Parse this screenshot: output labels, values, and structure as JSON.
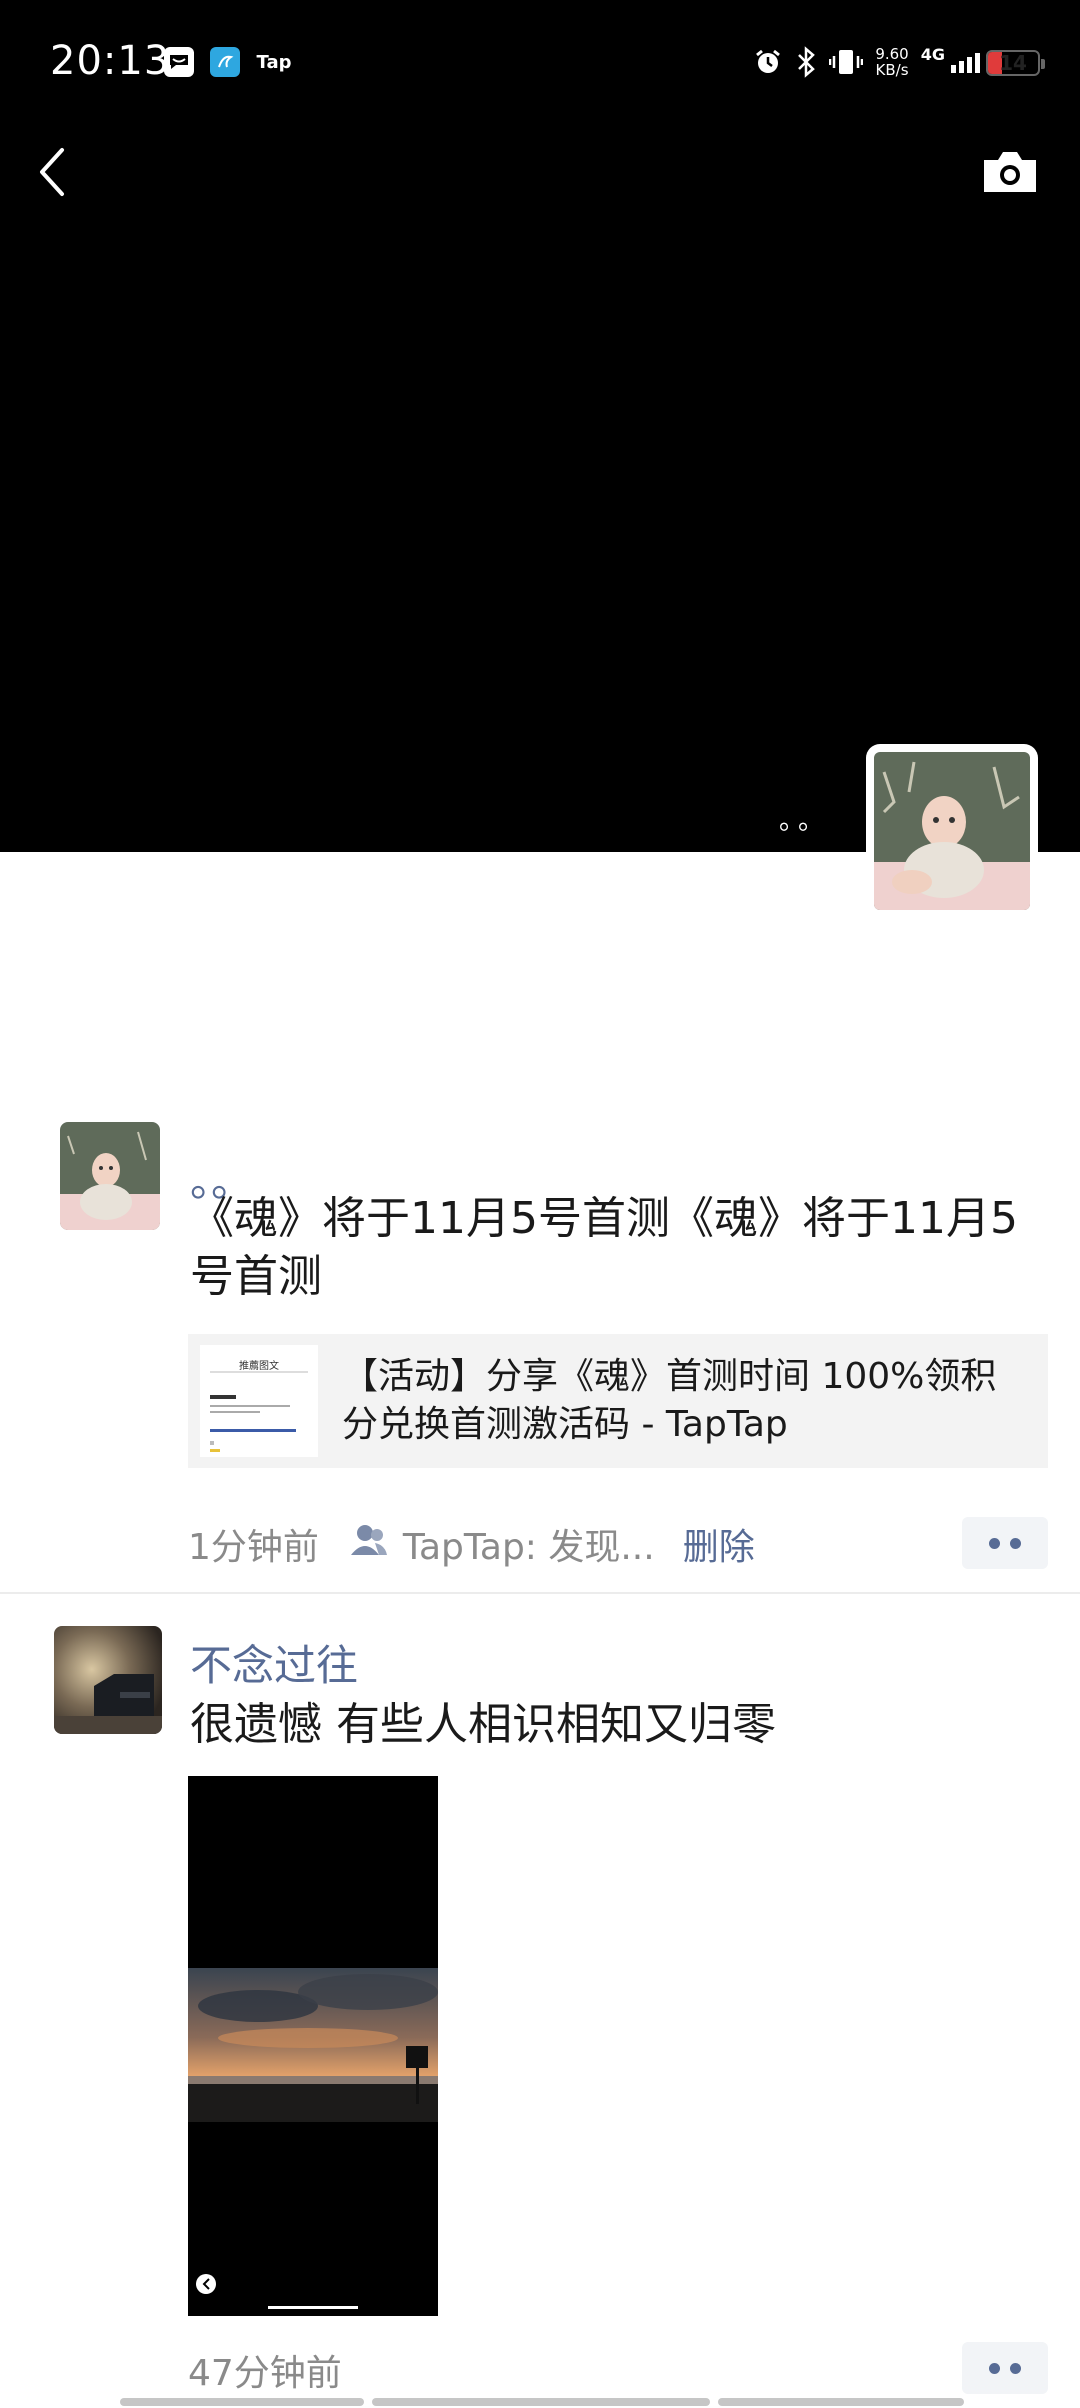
{
  "status_bar": {
    "time": "20:13",
    "app_icons": [
      "message-icon",
      "note-app-icon",
      "tap-app-icon"
    ],
    "tap_label": "Tap",
    "net_speed_value": "9.60",
    "net_speed_unit": "KB/s",
    "network_type": "4G",
    "battery_level": "14"
  },
  "cover": {
    "owner_name": "。。",
    "back_icon": "chevron-left-icon",
    "camera_icon": "camera-icon"
  },
  "posts": [
    {
      "name": "。。",
      "text": "《魂》将于11月5号首测《魂》将于11月5号首测",
      "link_card": {
        "title": "【活动】分享《魂》首测时间 100%领积分兑换首测激活码 - TapTap",
        "thumb_header": "推薦图文"
      },
      "time": "1分钟前",
      "source": "TapTap: 发现...",
      "delete_label": "删除"
    },
    {
      "name": "不念过往",
      "text": "很遗憾  有些人相识相知又归零",
      "time": "47分钟前"
    }
  ],
  "colors": {
    "link_blue": "#576b95",
    "cover_black": "#000000",
    "battery_red": "#e03b3b"
  }
}
